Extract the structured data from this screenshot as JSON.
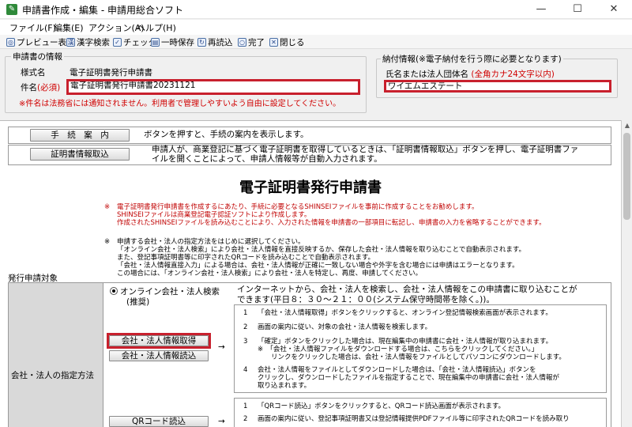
{
  "window": {
    "title": "申請書作成・編集 - 申請用総合ソフト",
    "minimize": "—",
    "maximize": "☐",
    "close": "✕"
  },
  "menu": [
    "ファイル(F)",
    "編集(E)",
    "アクション(A)",
    "ヘルプ(H)"
  ],
  "toolbar": {
    "preview": "プレビュー表示",
    "kanji": "漢字検索",
    "check": "チェック",
    "save": "一時保存",
    "reload": "再読込",
    "done": "完了",
    "close": "閉じる"
  },
  "app_info": {
    "group_label": "申請書の情報",
    "style_label": "様式名",
    "style_value": "電子証明書発行申請書",
    "subject_label": "件名",
    "required": "(必須)",
    "subject_value": "電子証明書発行申請書20231121",
    "note": "※件名は法務省には通知されません。利用者で管理しやすいよう自由に設定してください。"
  },
  "payment": {
    "group_label": "納付情報(※電子納付を行う際に必要となります)",
    "name_label": "氏名または法人団体名",
    "name_hint": "(全角カナ24文字以内)",
    "name_value": "ワイエムエステート"
  },
  "doc": {
    "guide_button": "手　続　案　内",
    "guide_desc": "ボタンを押すと、手続の案内を表示します。",
    "cert_button": "証明書情報取込",
    "cert_desc_1": "申請人が、商業登記に基づく電子証明書を取得しているときは、「証明書情報取込」ボタンを押し、電子証明書ファ",
    "cert_desc_2": "イルを開くことによって、申請人情報等が自動入力されます。",
    "heading": "電子証明書発行申請書",
    "mark": "※",
    "notice1": [
      "電子証明書発行申請書を作成するにあたり、手続に必要となるSHINSEIファイルを事前に作成することをお勧めします。",
      "SHINSEIファイルは商業登記電子認証ソフトにより作成します。",
      "作成されたSHINSEIファイルを読み込むことにより、入力された情報を申請書の一部項目に転記し、申請書の入力を省略することができます。"
    ],
    "notice2": [
      "申請する会社・法人の指定方法をはじめに選択してください。",
      "「オンライン会社・法人検索」により会社・法人情報を直接反映するか、保存した会社・法人情報を取り込むことで自動表示されます。",
      "また、登記事項証明書等に印字されたQRコードを読み込むことで自動表示されます。",
      "「会社・法人情報直接入力」による場合は、会社・法人情報が正確に一致しない場合や外字を含む場合には申請はエラーとなります。",
      "この場合には、「オンライン会社・法人検索」により会社・法人を特定し、再度、申請してください。"
    ],
    "section_label": "発行申請対象",
    "method_label": "会社・法人の指定方法",
    "radio_online": "オンライン会社・法人検索",
    "radio_online_sub": "(推奨)",
    "online_desc_1": "インターネットから、会社・法人を検索し、会社・法人情報をこの申請書に取り込むことが",
    "online_desc_2": "できます(平日８：３０～２１：００(システム保守時間帯を除く。))。",
    "get_button": "会社・法人情報取得",
    "read_button": "会社・法人情報読込",
    "arrow": "→",
    "steps": [
      {
        "n": "1",
        "lines": [
          "「会社・法人情報取得」ボタンをクリックすると、オンライン登記情報検索画面が表示されます。"
        ]
      },
      {
        "n": "2",
        "lines": [
          "画面の案内に従い、対象の会社・法人情報を検索します。"
        ]
      },
      {
        "n": "3",
        "lines": [
          "「確定」ボタンをクリックした場合は、現在編集中の申請書に会社・法人情報が取り込まれます。",
          "※　「会社・法人情報ファイルをダウンロードする場合は、こちらをクリックしてください。」",
          "　　リンクをクリックした場合は、会社・法人情報をファイルとしてパソコンにダウンロードします。"
        ]
      },
      {
        "n": "4",
        "lines": [
          "会社・法人情報をファイルとしてダウンロードした場合は、「会社・法人情報読込」ボタンを",
          "クリックし、ダウンロードしたファイルを指定することで、現在編集中の申請書に会社・法人情報が",
          "取り込まれます。"
        ]
      }
    ],
    "qr_button": "QRコード読込",
    "qr_steps": [
      {
        "n": "1",
        "lines": [
          "「QRコード読込」ボタンをクリックすると、QRコード読込画面が表示されます。"
        ]
      },
      {
        "n": "2",
        "lines": [
          "画面の案内に従い、登記事項証明書又は登記情報提供PDFファイル等に印字されたQRコードを読み取り"
        ]
      }
    ]
  }
}
